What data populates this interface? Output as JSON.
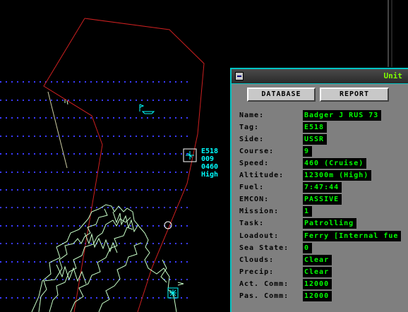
{
  "contact": {
    "tag": "E518",
    "course": "009",
    "speed": "0460",
    "altitude": "High"
  },
  "unit_panel": {
    "title": "Unit",
    "buttons": {
      "database": "DATABASE",
      "report": "REPORT"
    },
    "fields": [
      {
        "label": "Name:",
        "value": "Badger J RUS 73"
      },
      {
        "label": "Tag:",
        "value": "E518"
      },
      {
        "label": "Side:",
        "value": "USSR"
      },
      {
        "label": "Course:",
        "value": "9"
      },
      {
        "label": "Speed:",
        "value": "460 (Cruise)"
      },
      {
        "label": "Altitude:",
        "value": "12300m (High)"
      },
      {
        "label": "Fuel:",
        "value": "7:47:44"
      },
      {
        "label": "EMCON:",
        "value": "PASSIVE"
      },
      {
        "label": "Mission:",
        "value": "1"
      },
      {
        "label": "Task:",
        "value": "Patrolling"
      },
      {
        "label": "Loadout:",
        "value": "Ferry [Internal fue"
      },
      {
        "label": "Sea State:",
        "value": "0"
      },
      {
        "label": "Clouds:",
        "value": "Clear"
      },
      {
        "label": "Precip:",
        "value": "Clear"
      },
      {
        "label": "Act. Comm:",
        "value": "12000"
      },
      {
        "label": "Pas. Comm:",
        "value": "12000"
      }
    ]
  },
  "colors": {
    "background": "#000000",
    "sonar_lines": "#3a3aff",
    "patrol_zone": "#cc2020",
    "coastline": "#c8ffc8",
    "contact": "#00ffff",
    "value_text": "#00ff00",
    "panel": "#7f7f7f",
    "panel_border": "#00c4c4"
  }
}
